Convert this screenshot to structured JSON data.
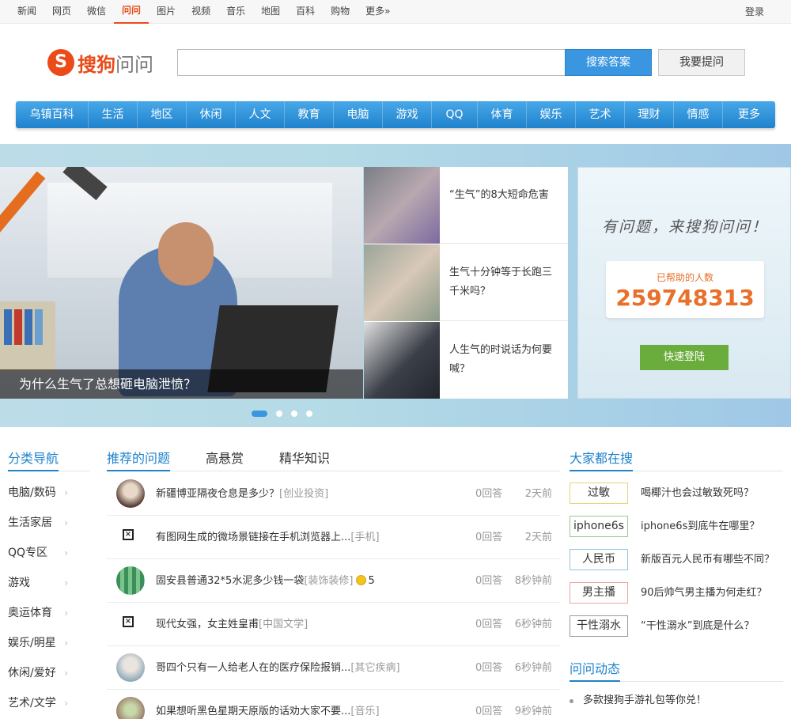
{
  "topnav": {
    "links": [
      "新闻",
      "网页",
      "微信",
      "问问",
      "图片",
      "视频",
      "音乐",
      "地图",
      "百科",
      "购物",
      "更多»"
    ],
    "login": "登录"
  },
  "logo": {
    "brand": "搜狗",
    "product": "问问"
  },
  "search": {
    "placeholder": "",
    "button": "搜索答案",
    "ask_button": "我要提问"
  },
  "categories": [
    "乌镇百科",
    "生活",
    "地区",
    "休闲",
    "人文",
    "教育",
    "电脑",
    "游戏",
    "QQ",
    "体育",
    "娱乐",
    "艺术",
    "理财",
    "情感",
    "更多"
  ],
  "banner": {
    "hero_caption": "为什么生气了总想砸电脑泄愤？",
    "thumbs": [
      "“生气”的8大短命危害",
      "生气十分钟等于长跑三千米吗？",
      "人生气的时说话为何要喊？"
    ],
    "slogan": "有问题，来搜狗问问！",
    "helped_label": "已帮助的人数",
    "helped_count": "259748313",
    "quick_login": "快速登陆",
    "active_dot": 1
  },
  "category_nav": {
    "title": "分类导航",
    "items": [
      "电脑/数码",
      "生活家居",
      "QQ专区",
      "游戏",
      "奥运体育",
      "娱乐/明星",
      "休闲/爱好",
      "艺术/文学"
    ]
  },
  "tabs": [
    "推荐的问题",
    "高悬赏",
    "精华知识"
  ],
  "questions": [
    {
      "title": "新疆博亚隔夜仓息是多少？",
      "tag": "[创业投资]",
      "answers": "0回答",
      "time": "2天前"
    },
    {
      "title": "有图网生成的微场景链接在手机浏览器上...",
      "tag": "[手机]",
      "answers": "0回答",
      "time": "2天前"
    },
    {
      "title": "固安县普通32*5水泥多少钱一袋",
      "tag": "[装饰装修]",
      "reward": "5",
      "answers": "0回答",
      "time": "8秒钟前"
    },
    {
      "title": "现代女强，女主姓皇甫",
      "tag": "[中国文学]",
      "answers": "0回答",
      "time": "6秒钟前"
    },
    {
      "title": "哥四个只有一人给老人在的医疗保险报销...",
      "tag": "[其它疾病]",
      "answers": "0回答",
      "time": "6秒钟前"
    },
    {
      "title": "如果想听黑色星期天原版的话劝大家不要...",
      "tag": "[音乐]",
      "answers": "0回答",
      "time": "9秒钟前"
    }
  ],
  "hot_search": {
    "title": "大家都在搜",
    "items": [
      {
        "keyword": "过敏",
        "border": "#e8d37a",
        "text": "喝椰汁也会过敏致死吗？"
      },
      {
        "keyword": "iphone6s",
        "border": "#9cc98c",
        "text": "iphone6s到底牛在哪里？"
      },
      {
        "keyword": "人民币",
        "border": "#8fc7e6",
        "text": "新版百元人民币有哪些不同？"
      },
      {
        "keyword": "男主播",
        "border": "#e9a7a2",
        "text": "90后帅气男主播为何走红？"
      },
      {
        "keyword": "干性溺水",
        "border": "#999999",
        "text": "“干性溺水”到底是什么？"
      }
    ]
  },
  "dynamics": {
    "title": "问问动态",
    "items": [
      "多款搜狗手游礼包等你兑！"
    ]
  },
  "colors": {
    "accent": "#1f82cc",
    "brand": "#ea4b19",
    "counter": "#e8702a",
    "green": "#6bad3c"
  }
}
